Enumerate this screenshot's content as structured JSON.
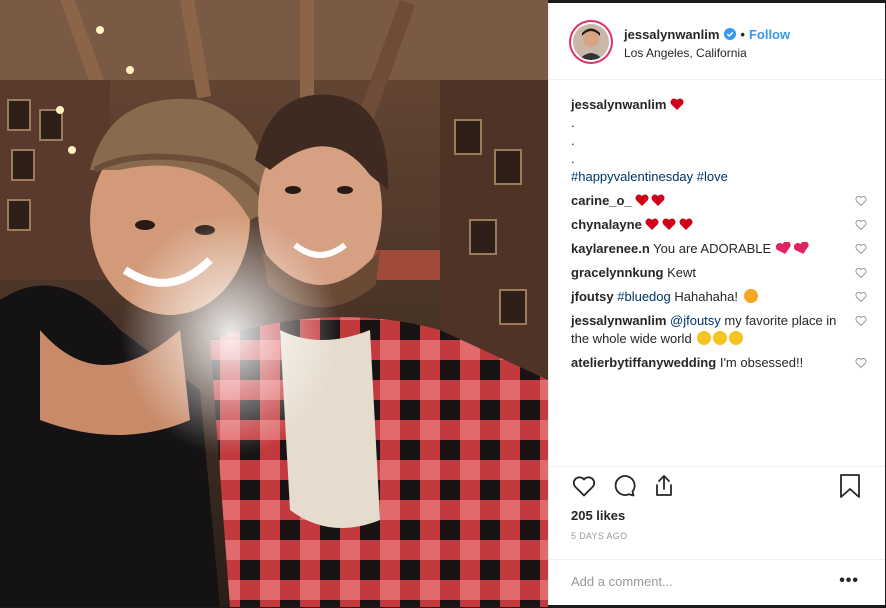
{
  "post": {
    "author": "jessalynwanlim",
    "follow_label": "Follow",
    "separator": "•",
    "location": "Los Angeles, California",
    "caption_author": "jessalynwanlim",
    "caption_lines": [
      ".",
      ".",
      "."
    ],
    "hashtag_1": "#happyvalentinesday",
    "hashtag_2": "#love"
  },
  "comments": [
    {
      "user": "carine_o_",
      "text": ""
    },
    {
      "user": "chynalayne",
      "text": ""
    },
    {
      "user": "kaylarenee.n",
      "text": "You are ADORABLE"
    },
    {
      "user": "gracelynnkung",
      "text": "Kewt"
    },
    {
      "user": "jfoutsy",
      "tag": "#bluedog",
      "text": "Hahahaha!"
    },
    {
      "user": "jessalynwanlim",
      "mention": "@jfoutsy",
      "text": "my favorite place in the whole wide world"
    },
    {
      "user": "atelierbytiffanywedding",
      "text": "I'm obsessed!!"
    }
  ],
  "stats": {
    "likes": "205 likes",
    "time": "5 DAYS AGO"
  },
  "composer": {
    "placeholder": "Add a comment...",
    "more": "•••"
  },
  "colors": {
    "accent": "#3897f0",
    "heart_red": "#ed4956",
    "text": "#262626",
    "muted": "#999999"
  },
  "icons": [
    "verified-badge-icon",
    "heart-icon",
    "comment-icon",
    "share-icon",
    "bookmark-icon",
    "more-options-icon"
  ]
}
